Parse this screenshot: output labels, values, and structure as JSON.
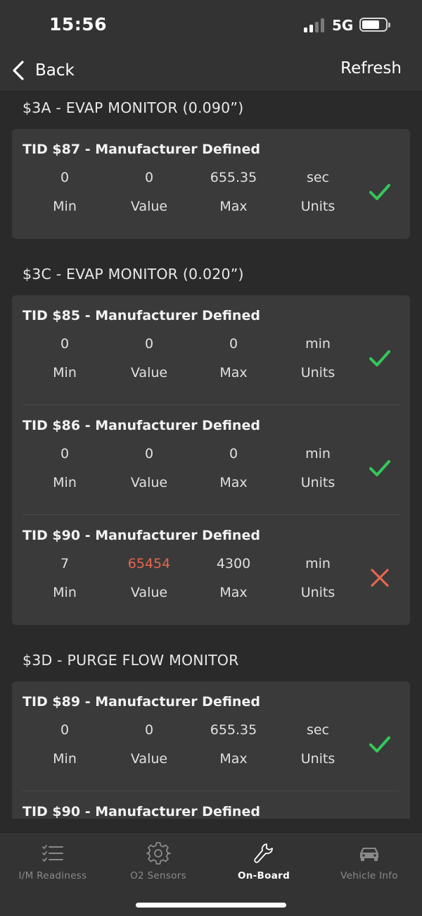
{
  "status_bar": {
    "time": "15:56",
    "network": "5G"
  },
  "nav": {
    "back_label": "Back",
    "refresh_label": "Refresh"
  },
  "column_labels": {
    "min": "Min",
    "value": "Value",
    "max": "Max",
    "units": "Units"
  },
  "sections": [
    {
      "title": "$3A - EVAP MONITOR (0.090”)",
      "tests": [
        {
          "title": "TID $87 - Manufacturer Defined",
          "min": "0",
          "value": "0",
          "max": "655.35",
          "units": "sec",
          "status": "pass"
        }
      ]
    },
    {
      "title": "$3C - EVAP MONITOR (0.020”)",
      "tests": [
        {
          "title": "TID $85 - Manufacturer Defined",
          "min": "0",
          "value": "0",
          "max": "0",
          "units": "min",
          "status": "pass"
        },
        {
          "title": "TID $86 - Manufacturer Defined",
          "min": "0",
          "value": "0",
          "max": "0",
          "units": "min",
          "status": "pass"
        },
        {
          "title": "TID $90 - Manufacturer Defined",
          "min": "7",
          "value": "65454",
          "max": "4300",
          "units": "min",
          "status": "fail"
        }
      ]
    },
    {
      "title": "$3D - PURGE FLOW MONITOR",
      "tests": [
        {
          "title": "TID $89 - Manufacturer Defined",
          "min": "0",
          "value": "0",
          "max": "655.35",
          "units": "sec",
          "status": "pass"
        },
        {
          "title": "TID $90 - Manufacturer Defined"
        }
      ]
    }
  ],
  "tabbar": {
    "tabs": [
      {
        "label": "I/M Readiness",
        "icon": "checklist-icon",
        "active": false
      },
      {
        "label": "O2 Sensors",
        "icon": "gear-icon",
        "active": false
      },
      {
        "label": "On-Board",
        "icon": "wrench-icon",
        "active": true
      },
      {
        "label": "Vehicle Info",
        "icon": "car-icon",
        "active": false
      }
    ]
  },
  "colors": {
    "pass": "#34c759",
    "fail": "#e5664f",
    "background": "#2a2a2a",
    "card": "#3a3a3a"
  }
}
